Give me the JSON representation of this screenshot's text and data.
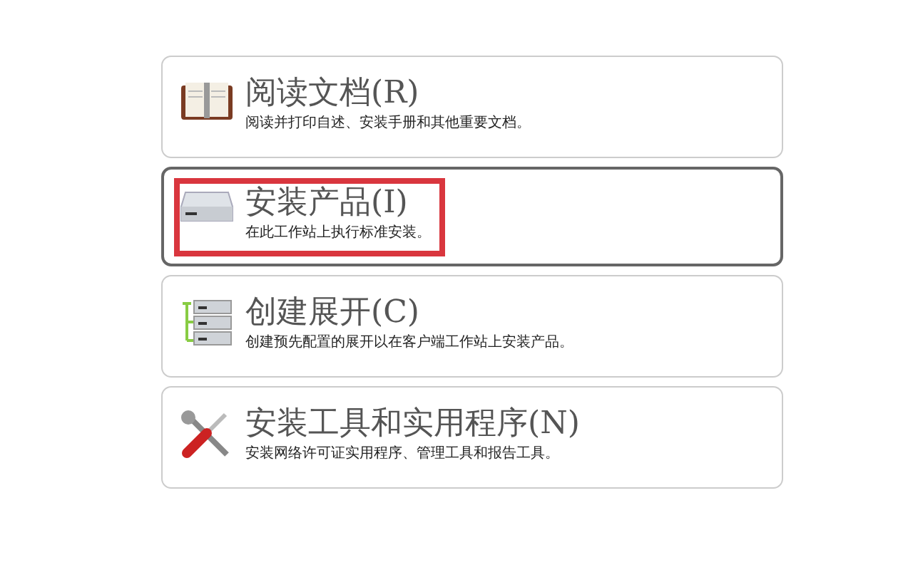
{
  "options": [
    {
      "kind": "documents",
      "title": "阅读文档(R)",
      "description": "阅读并打印自述、安装手册和其他重要文档。",
      "selected": false,
      "highlighted": false
    },
    {
      "kind": "install",
      "title": "安装产品(I)",
      "description": "在此工作站上执行标准安装。",
      "selected": true,
      "highlighted": true
    },
    {
      "kind": "deploy",
      "title": "创建展开(C)",
      "description": "创建预先配置的展开以在客户端工作站上安装产品。",
      "selected": false,
      "highlighted": false
    },
    {
      "kind": "tools",
      "title": "安装工具和实用程序(N)",
      "description": "安装网络许可证实用程序、管理工具和报告工具。",
      "selected": false,
      "highlighted": false
    }
  ]
}
